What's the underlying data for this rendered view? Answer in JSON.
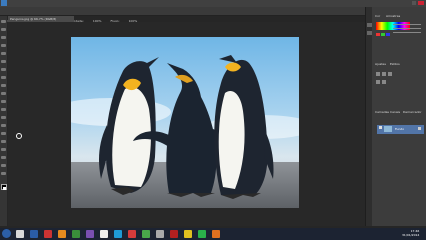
{
  "menubar": {
    "items": [
      "Ps",
      "Arquivo",
      "Editar",
      "Imagem",
      "Camada",
      "Texto",
      "Selecionar",
      "Filtro",
      "3D",
      "Visualizar",
      "Janela",
      "Ajuda"
    ]
  },
  "options_bar": {
    "items": [
      "Ferramenta",
      "Modo:",
      "Normal",
      "Opacidade:",
      "100%",
      "Fluxo:",
      "100%"
    ]
  },
  "document": {
    "tab_label": "Penguins.jpg @ 66,7% (RGB/8)"
  },
  "panels": {
    "color_tabs": [
      "Cor",
      "Amostras"
    ],
    "adjust_tabs": [
      "Ajustes",
      "Estilos"
    ],
    "layer_tabs": [
      "Camadas",
      "Canais",
      "Demarcador"
    ],
    "layer_name": "Fundo"
  },
  "colors": {
    "accent": "#3b7bbf",
    "layer_selected": "#5275a8"
  },
  "taskbar": {
    "time": "17:46",
    "date": "31/01/2014"
  }
}
